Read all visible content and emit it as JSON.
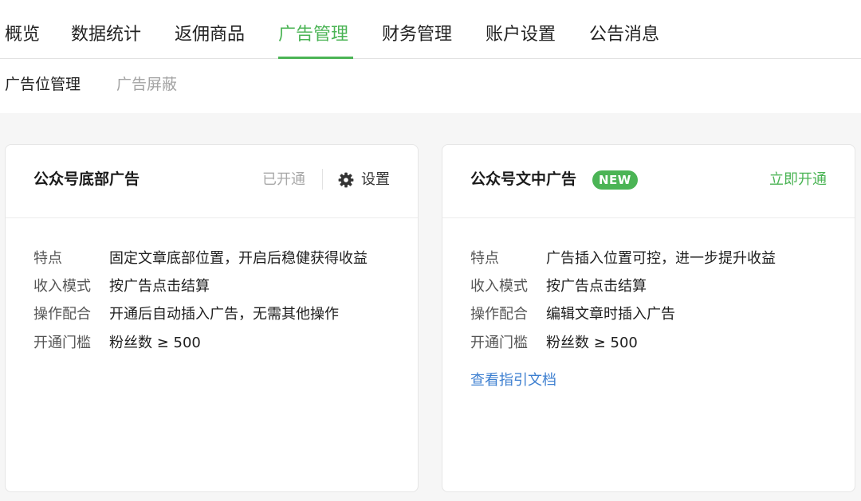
{
  "top_nav": {
    "tabs": [
      {
        "label": "概览",
        "active": false
      },
      {
        "label": "数据统计",
        "active": false
      },
      {
        "label": "返佣商品",
        "active": false
      },
      {
        "label": "广告管理",
        "active": true
      },
      {
        "label": "财务管理",
        "active": false
      },
      {
        "label": "账户设置",
        "active": false
      },
      {
        "label": "公告消息",
        "active": false
      }
    ]
  },
  "sub_nav": {
    "tabs": [
      {
        "label": "广告位管理",
        "active": true
      },
      {
        "label": "广告屏蔽",
        "active": false
      }
    ]
  },
  "cards": [
    {
      "title": "公众号底部广告",
      "status": "已开通",
      "settings_label": "设置",
      "icon": "gear-icon",
      "features": [
        {
          "label": "特点",
          "value": "固定文章底部位置，开启后稳健获得收益"
        },
        {
          "label": "收入模式",
          "value": "按广告点击结算"
        },
        {
          "label": "操作配合",
          "value": "开通后自动插入广告，无需其他操作"
        },
        {
          "label": "开通门槛",
          "value": "粉丝数 ≥ 500"
        }
      ]
    },
    {
      "title": "公众号文中广告",
      "badge": "NEW",
      "action_label": "立即开通",
      "features": [
        {
          "label": "特点",
          "value": "广告插入位置可控，进一步提升收益"
        },
        {
          "label": "收入模式",
          "value": "按广告点击结算"
        },
        {
          "label": "操作配合",
          "value": "编辑文章时插入广告"
        },
        {
          "label": "开通门槛",
          "value": "粉丝数 ≥ 500"
        }
      ],
      "doc_link": "查看指引文档"
    }
  ],
  "colors": {
    "accent": "#4bb455",
    "link": "#3d7fd0",
    "muted": "#a8a8a8",
    "page_background": "#f6f6f6"
  }
}
